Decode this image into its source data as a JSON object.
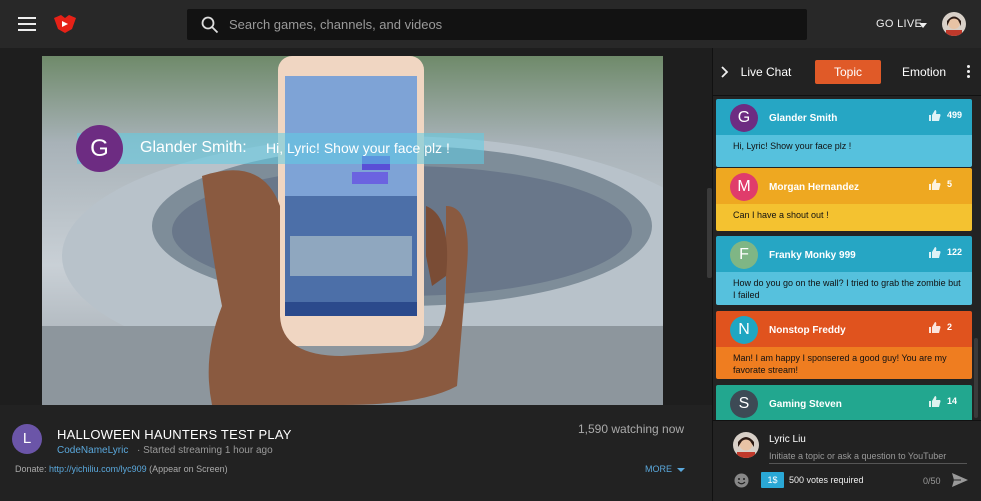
{
  "header": {
    "search_placeholder": "Search games, channels, and videos",
    "go_live": "GO LIVE",
    "icons": [
      "menu-icon",
      "gaming-logo-icon",
      "search-icon",
      "chevron-down-icon",
      "user-avatar"
    ]
  },
  "video": {
    "overlay": {
      "avatar_letter": "G",
      "name": "Glander Smith:",
      "message": "Hi, Lyric!  Show your face plz !"
    }
  },
  "stream": {
    "avatar_letter": "L",
    "title": "HALLOWEEN HAUNTERS TEST PLAY",
    "channel": "CodeNameLyric",
    "started": "Started streaming 1 hour ago",
    "watching": "1,590 watching now",
    "donate_label": "Donate:",
    "donate_link": "http://yichiliu.com/lyc909",
    "donate_note": "(Appear on Screen)",
    "more": "MORE"
  },
  "chat": {
    "tabs": [
      {
        "label": "Live Chat",
        "active": false
      },
      {
        "label": "Topic",
        "active": true
      },
      {
        "label": "Emotion",
        "active": false
      }
    ],
    "messages": [
      {
        "letter": "G",
        "name": "Glander Smith",
        "likes": "499",
        "text": "Hi, Lyric!  Show your face plz !",
        "head_color": "#26a6c4",
        "body_color": "#56c1dd",
        "avatar_color": "#6d2c82"
      },
      {
        "letter": "M",
        "name": "Morgan Hernandez",
        "likes": "5",
        "text": "Can I have a shout out !",
        "head_color": "#eea821",
        "body_color": "#f4c230",
        "avatar_color": "#e03c6b"
      },
      {
        "letter": "F",
        "name": "Franky Monky 999",
        "likes": "122",
        "text": "How do you go on the wall? I tried to grab the zombie but I failed",
        "head_color": "#26a6c4",
        "body_color": "#56c1dd",
        "avatar_color": "#7fb685"
      },
      {
        "letter": "N",
        "name": "Nonstop Freddy",
        "likes": "2",
        "text": "Man! I am happy I sponsered a good guy! You are my favorate stream!",
        "head_color": "#e0531e",
        "body_color": "#ef7d20",
        "avatar_color": "#1fa6c2"
      },
      {
        "letter": "S",
        "name": "Gaming Steven",
        "likes": "14",
        "text": "",
        "head_color": "#22a78f",
        "body_color": "#3bbda4",
        "avatar_color": "#3d4a55"
      }
    ],
    "composer": {
      "user_name": "Lyric Liu",
      "placeholder": "Initiate a topic or ask a question to YouTuber",
      "price": "1$",
      "votes": "500 votes required",
      "char_count": "0/50"
    }
  }
}
